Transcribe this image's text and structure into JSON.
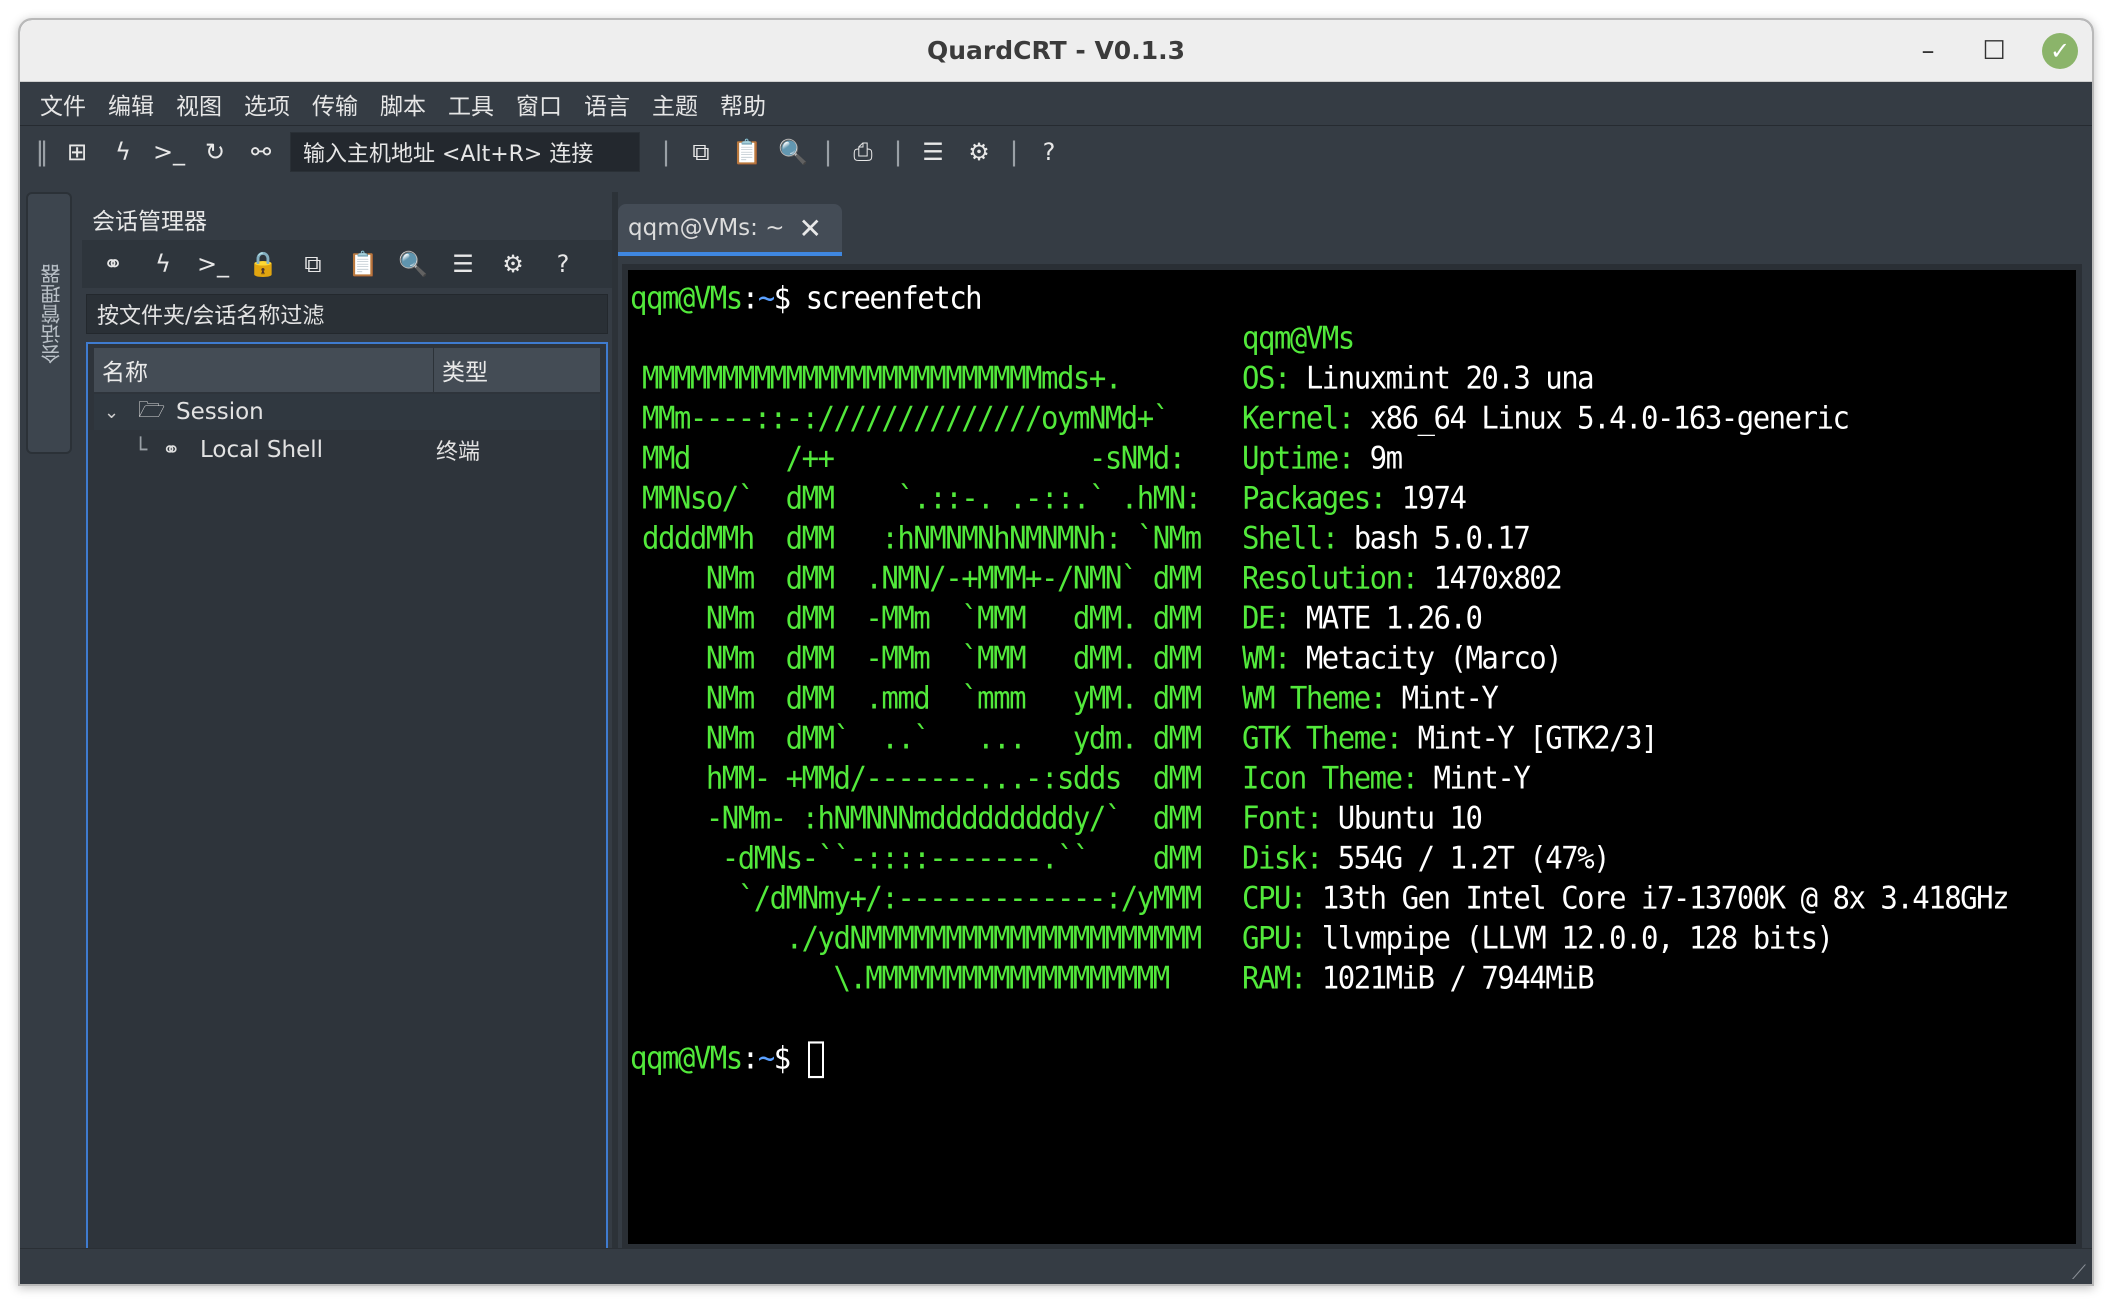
{
  "window": {
    "title": "QuardCRT - V0.1.3"
  },
  "menubar": [
    "文件",
    "编辑",
    "视图",
    "选项",
    "传输",
    "脚本",
    "工具",
    "窗口",
    "语言",
    "主题",
    "帮助"
  ],
  "toolbar": {
    "host_placeholder": "输入主机地址 <Alt+R> 连接"
  },
  "session_panel": {
    "side_tab": "会话管理器",
    "title": "会话管理器",
    "filter_placeholder": "按文件夹/会话名称过滤",
    "col_name": "名称",
    "col_type": "类型",
    "items": [
      {
        "label": "Session",
        "type": ""
      },
      {
        "label": "Local Shell",
        "type": "终端"
      }
    ]
  },
  "terminal": {
    "tab_label": "qqm@VMs: ~",
    "prompt_user": "qqm@VMs",
    "prompt_path": "~",
    "prompt_sym": "$",
    "command": " screenfetch",
    "logo": [
      "",
      "MMMMMMMMMMMMMMMMMMMMMMMMMmds+.",
      "MMm----::-://////////////oymNMd+`",
      "MMd      /++                -sNMd:",
      "MMNso/`  dMM    `.::-. .-::.` .hMN:",
      "ddddMMh  dMM   :hNMNMNhNMNMNh: `NMm",
      "    NMm  dMM  .NMN/-+MMM+-/NMN` dMM",
      "    NMm  dMM  -MMm  `MMM   dMM. dMM",
      "    NMm  dMM  -MMm  `MMM   dMM. dMM",
      "    NMm  dMM  .mmd  `mmm   yMM. dMM",
      "    NMm  dMM`  ..`   ...   ydm. dMM",
      "    hMM- +MMd/-------...-:sdds  dMM",
      "    -NMm- :hNMNNNmdddddddddy/`  dMM",
      "     -dMNs-``-::::-------.``    dMM",
      "      `/dMNmy+/:-------------:/yMMM",
      "         ./ydNMMMMMMMMMMMMMMMMMMMMM",
      "            \\.MMMMMMMMMMMMMMMMMMM"
    ],
    "info_header": "qqm@VMs",
    "info": [
      {
        "key": "OS:",
        "val": " Linuxmint 20.3 una"
      },
      {
        "key": "Kernel:",
        "val": " x86_64 Linux 5.4.0-163-generic"
      },
      {
        "key": "Uptime:",
        "val": " 9m"
      },
      {
        "key": "Packages:",
        "val": " 1974"
      },
      {
        "key": "Shell:",
        "val": " bash 5.0.17"
      },
      {
        "key": "Resolution:",
        "val": " 1470x802"
      },
      {
        "key": "DE:",
        "val": " MATE 1.26.0"
      },
      {
        "key": "WM:",
        "val": " Metacity (Marco)"
      },
      {
        "key": "WM Theme:",
        "val": " Mint-Y"
      },
      {
        "key": "GTK Theme:",
        "val": " Mint-Y [GTK2/3]"
      },
      {
        "key": "Icon Theme:",
        "val": " Mint-Y"
      },
      {
        "key": "Font:",
        "val": " Ubuntu 10"
      },
      {
        "key": "Disk:",
        "val": " 554G / 1.2T (47%)"
      },
      {
        "key": "CPU:",
        "val": " 13th Gen Intel Core i7-13700K @ 8x 3.418GHz"
      },
      {
        "key": "GPU:",
        "val": " llvmpipe (LLVM 12.0.0, 128 bits)"
      },
      {
        "key": "RAM:",
        "val": " 1021MiB / 7944MiB"
      }
    ]
  },
  "colors": {
    "accent": "#3f87e0",
    "terminal_green": "#52e93b",
    "path_blue": "#5aa0ff"
  },
  "icons": [
    "sessions-icon",
    "flash-icon",
    "terminal-icon",
    "refresh-icon",
    "disconnect-icon",
    "copy-icon",
    "paste-icon",
    "search-icon",
    "print-icon",
    "settings-sliders-icon",
    "gear-icon",
    "help-icon"
  ]
}
